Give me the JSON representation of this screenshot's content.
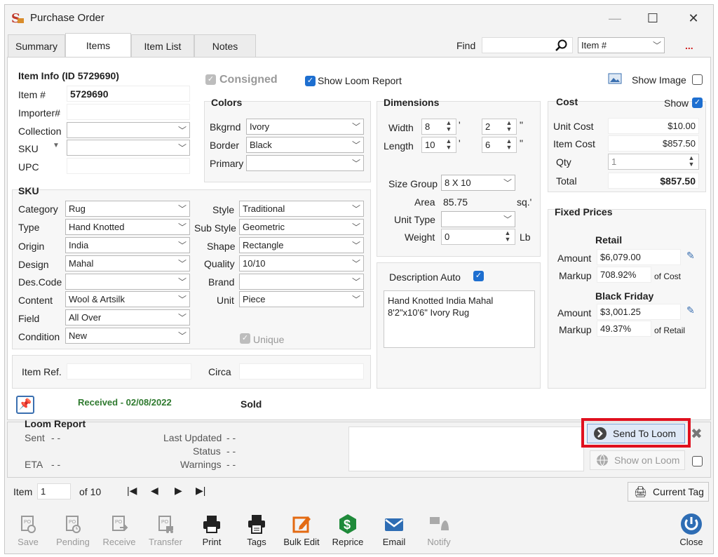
{
  "window": {
    "title": "Purchase Order",
    "minimize": "—",
    "maximize": "☐",
    "close": "✕"
  },
  "tabs": [
    "Summary",
    "Items",
    "Item List",
    "Notes"
  ],
  "find": {
    "label": "Find",
    "value": "",
    "by": "Item #",
    "more": "..."
  },
  "item_info": {
    "header": "Item Info (ID 5729690)",
    "item_label": "Item #",
    "item_value": "5729690",
    "importer_label": "Importer#",
    "collection_label": "Collection",
    "sku_label": "SKU",
    "upc_label": "UPC"
  },
  "flags": {
    "consigned": "Consigned",
    "show_loom_report": "Show Loom Report",
    "show_image": "Show Image",
    "unique": "Unique"
  },
  "colors": {
    "header": "Colors",
    "bkgrnd_label": "Bkgrnd",
    "bkgrnd": "Ivory",
    "border_label": "Border",
    "border": "Black",
    "primary_label": "Primary",
    "primary": ""
  },
  "dimensions": {
    "header": "Dimensions",
    "width_label": "Width",
    "width_ft": "8",
    "width_in": "2",
    "length_label": "Length",
    "length_ft": "10",
    "length_in": "6",
    "ft_mark": "'",
    "in_mark": "\"",
    "size_group_label": "Size Group",
    "size_group": "8 X 10",
    "area_label": "Area",
    "area": "85.75",
    "area_unit": "sq.'",
    "unit_type_label": "Unit Type",
    "unit_type": "",
    "weight_label": "Weight",
    "weight": "0",
    "weight_unit": "Lb"
  },
  "cost": {
    "header": "Cost",
    "show_label": "Show",
    "unit_cost_label": "Unit Cost",
    "unit_cost": "$10.00",
    "item_cost_label": "Item Cost",
    "item_cost": "$857.50",
    "qty_label": "Qty",
    "qty": "1",
    "total_label": "Total",
    "total": "$857.50"
  },
  "sku": {
    "header": "SKU",
    "category_label": "Category",
    "category": "Rug",
    "type_label": "Type",
    "type": "Hand Knotted",
    "origin_label": "Origin",
    "origin": "India",
    "design_label": "Design",
    "design": "Mahal",
    "descode_label": "Des.Code",
    "descode": "",
    "content_label": "Content",
    "content": "Wool & Artsilk",
    "field_label": "Field",
    "field": "All Over",
    "condition_label": "Condition",
    "condition": "New",
    "style_label": "Style",
    "style": "Traditional",
    "substyle_label": "Sub Style",
    "substyle": "Geometric",
    "shape_label": "Shape",
    "shape": "Rectangle",
    "quality_label": "Quality",
    "quality": "10/10",
    "brand_label": "Brand",
    "brand": "",
    "unit_label": "Unit",
    "unit": "Piece"
  },
  "description": {
    "label": "Description Auto",
    "text1": "Hand Knotted India Mahal",
    "text2": "8'2\"x10'6\" Ivory Rug"
  },
  "fixed_prices": {
    "header": "Fixed Prices",
    "retail_header": "Retail",
    "amount_label": "Amount",
    "retail_amount": "$6,079.00",
    "markup_label": "Markup",
    "retail_markup": "708.92%",
    "of_cost": "of Cost",
    "bf_header": "Black Friday",
    "bf_amount": "$3,001.25",
    "bf_markup": "49.37%",
    "of_retail": "of Retail"
  },
  "refs": {
    "item_ref_label": "Item Ref.",
    "item_ref": "",
    "circa_label": "Circa",
    "circa": ""
  },
  "status": {
    "received": "Received - 02/08/2022",
    "sold": "Sold"
  },
  "loom": {
    "header": "Loom Report",
    "sent_label": "Sent",
    "sent": "- -",
    "eta_label": "ETA",
    "eta": "- -",
    "updated_label": "Last Updated",
    "updated": "- -",
    "status_label": "Status",
    "status": "- -",
    "warnings_label": "Warnings",
    "warnings": "- -",
    "send_button": "Send To Loom",
    "show_button": "Show on Loom"
  },
  "nav": {
    "item_label": "Item",
    "item_value": "1",
    "of_label": "of 10",
    "current_tag": "Current Tag"
  },
  "toolbar": [
    {
      "label": "Save",
      "icon": "save-icon",
      "enabled": false
    },
    {
      "label": "Pending",
      "icon": "pending-icon",
      "enabled": false
    },
    {
      "label": "Receive",
      "icon": "receive-icon",
      "enabled": false
    },
    {
      "label": "Transfer",
      "icon": "transfer-icon",
      "enabled": false
    },
    {
      "label": "Print",
      "icon": "print-icon",
      "enabled": true
    },
    {
      "label": "Tags",
      "icon": "tags-icon",
      "enabled": true
    },
    {
      "label": "Bulk Edit",
      "icon": "edit-icon",
      "enabled": true
    },
    {
      "label": "Reprice",
      "icon": "dollar-icon",
      "enabled": true
    },
    {
      "label": "Email",
      "icon": "email-icon",
      "enabled": true
    },
    {
      "label": "Notify",
      "icon": "notify-icon",
      "enabled": false
    },
    {
      "label": "Close",
      "icon": "power-icon",
      "enabled": true
    }
  ],
  "colors_theme": {
    "accent": "#1e6fd0",
    "highlight": "#e0101e",
    "received": "#2f7a2f",
    "orange": "#e36a12",
    "green": "#1f8a3a"
  }
}
